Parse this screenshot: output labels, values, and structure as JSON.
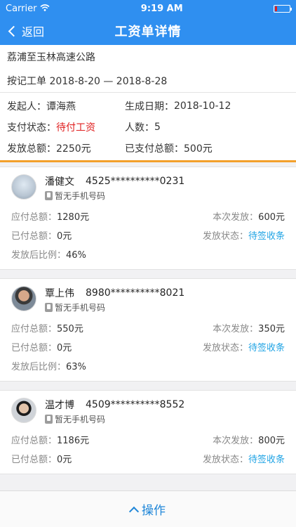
{
  "status_bar": {
    "carrier": "Carrier",
    "time": "9:19 AM"
  },
  "nav": {
    "back_label": "返回",
    "title": "工资单详情"
  },
  "info": {
    "road": "荔浦至玉林高速公路",
    "period": "按记工单 2018-8-20 — 2018-8-28",
    "initiator_label": "发起人：",
    "initiator": "谭海燕",
    "date_label": "生成日期：",
    "date": "2018-10-12",
    "pay_status_label": "支付状态：",
    "pay_status": "待付工资",
    "count_label": "人数：",
    "count": "5",
    "total_label": "发放总额：",
    "total": "2250元",
    "paid_total_label": "已支付总额：",
    "paid_total": "500元"
  },
  "labels": {
    "payable": "应付总额：",
    "this_pay": "本次发放：",
    "paid": "已付总额：",
    "pay_state": "发放状态：",
    "ratio": "发放后比例：",
    "no_phone": "暂无手机号码"
  },
  "workers": [
    {
      "name": "潘健文",
      "id": "4525**********0231",
      "payable": "1280元",
      "this_pay": "600元",
      "paid": "0元",
      "state": "待签收条",
      "ratio": "46%"
    },
    {
      "name": "覃上伟",
      "id": "8980**********8021",
      "payable": "550元",
      "this_pay": "350元",
      "paid": "0元",
      "state": "待签收条",
      "ratio": "63%"
    },
    {
      "name": "温才博",
      "id": "4509**********8552",
      "payable": "1186元",
      "this_pay": "800元",
      "paid": "0元",
      "state": "待签收条"
    }
  ],
  "bottom": {
    "action_label": "操作"
  },
  "colors": {
    "nav_blue": "#2f8ff0",
    "status_red": "#e02020",
    "link_blue": "#1fa3e4",
    "divider_orange": "#f3a02b"
  }
}
